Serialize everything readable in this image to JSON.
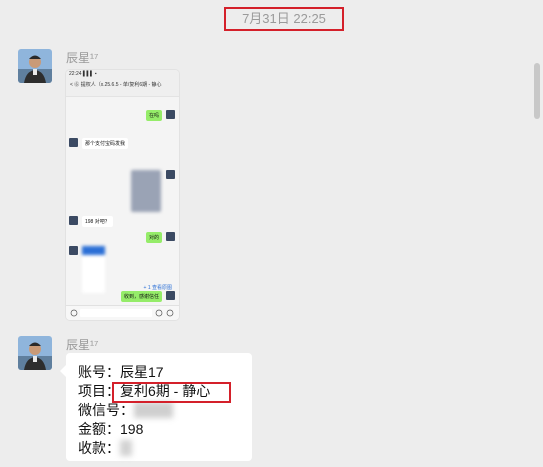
{
  "chat": {
    "timestamp": "7月31日 22:25",
    "messages": [
      {
        "sender": "辰星¹⁷",
        "type": "image",
        "screenshot": {
          "chat_name": "< ⑥ 提权人（x.25.6.5 - 单/复利6期 - 静心",
          "items": [
            {
              "side": "right",
              "text": "在吗"
            },
            {
              "side": "left",
              "text": "那个支付宝码发我"
            },
            {
              "side": "left",
              "text": "198 对吧？"
            },
            {
              "side": "right",
              "text": "对的"
            },
            {
              "side": "right",
              "text": "收到，感谢信任"
            }
          ],
          "link_text": "+ 1 查看原图"
        }
      },
      {
        "sender": "辰星¹⁷",
        "type": "text",
        "lines": [
          {
            "label": "账号：",
            "value": "辰星17"
          },
          {
            "label": "项目：",
            "value": "复利6期 - 静心"
          },
          {
            "label": "微信号：",
            "value": "          "
          },
          {
            "label": "金额：",
            "value": "198"
          },
          {
            "label": "收款：",
            "value": "   "
          }
        ]
      }
    ]
  },
  "colors": {
    "highlight": "#d4202a",
    "bubble_green": "#95ec69",
    "background": "#ededed"
  }
}
